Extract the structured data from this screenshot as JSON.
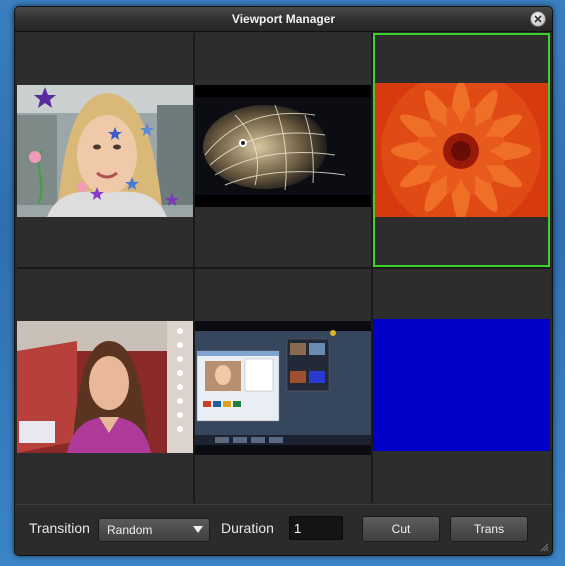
{
  "window": {
    "title": "Viewport Manager"
  },
  "viewports": [
    {
      "id": "vp-1",
      "content": "webcam-woman-with-stars",
      "selected": false
    },
    {
      "id": "vp-2",
      "content": "fractal-leopard",
      "selected": false
    },
    {
      "id": "vp-3",
      "content": "red-flower",
      "selected": true
    },
    {
      "id": "vp-4",
      "content": "news-anchor",
      "selected": false
    },
    {
      "id": "vp-5",
      "content": "desktop-screenshot",
      "selected": false
    },
    {
      "id": "vp-6",
      "content": "solid-blue",
      "selected": false
    }
  ],
  "controls": {
    "transition_label": "Transition",
    "transition_value": "Random",
    "duration_label": "Duration",
    "duration_value": "1",
    "cut_label": "Cut",
    "trans_label": "Trans"
  },
  "colors": {
    "selection_border": "#39d12a",
    "solid_blue": "#0000c8"
  }
}
